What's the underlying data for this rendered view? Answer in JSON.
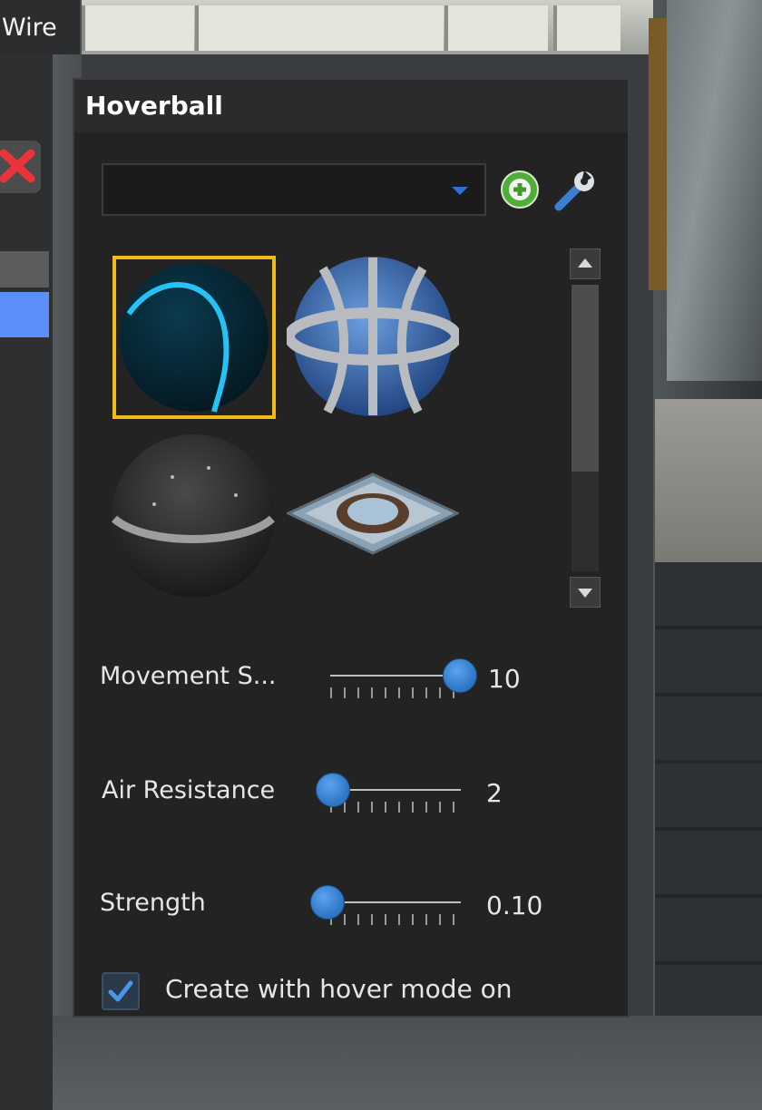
{
  "left_panel": {
    "tab_label": "Wire"
  },
  "panel": {
    "title": "Hoverball",
    "preset": {
      "selected": ""
    },
    "models": [
      {
        "name": "tennis-ball-model",
        "selected": true
      },
      {
        "name": "caged-sphere-model",
        "selected": false
      },
      {
        "name": "dark-sphere-model",
        "selected": false
      },
      {
        "name": "flat-plate-model",
        "selected": false
      }
    ],
    "sliders": [
      {
        "id": "movement-speed",
        "label": "Movement S...",
        "value": "10",
        "fraction": 1.0
      },
      {
        "id": "air-resistance",
        "label": "Air Resistance",
        "value": "2",
        "fraction": 0.0
      },
      {
        "id": "strength",
        "label": "Strength",
        "value": "0.10",
        "fraction": 0.0
      }
    ],
    "checkbox": {
      "label": "Create with hover mode on",
      "checked": true
    }
  },
  "colors": {
    "accent": "#2c74c4",
    "selection": "#f3b919",
    "close": "#e8343a"
  }
}
